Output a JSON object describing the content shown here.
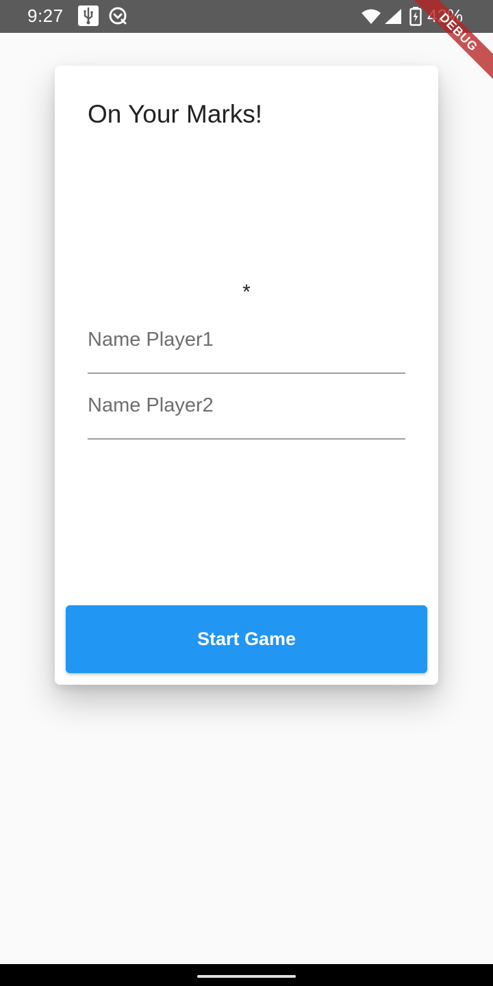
{
  "status_bar": {
    "time": "9:27",
    "battery": "42%",
    "icons": [
      "usb-icon",
      "sync-icon",
      "wifi-icon",
      "signal-icon",
      "battery-charging-icon"
    ]
  },
  "debug_banner": "DEBUG",
  "card": {
    "title": "On Your Marks!",
    "marker": "*",
    "player1": {
      "value": "",
      "placeholder": "Name Player1"
    },
    "player2": {
      "value": "",
      "placeholder": "Name Player2"
    },
    "start_button_label": "Start Game"
  },
  "colors": {
    "accent": "#2196f3",
    "status_bar": "#5b5b5b",
    "background": "#fafafa",
    "debug_banner": "#b82222"
  }
}
